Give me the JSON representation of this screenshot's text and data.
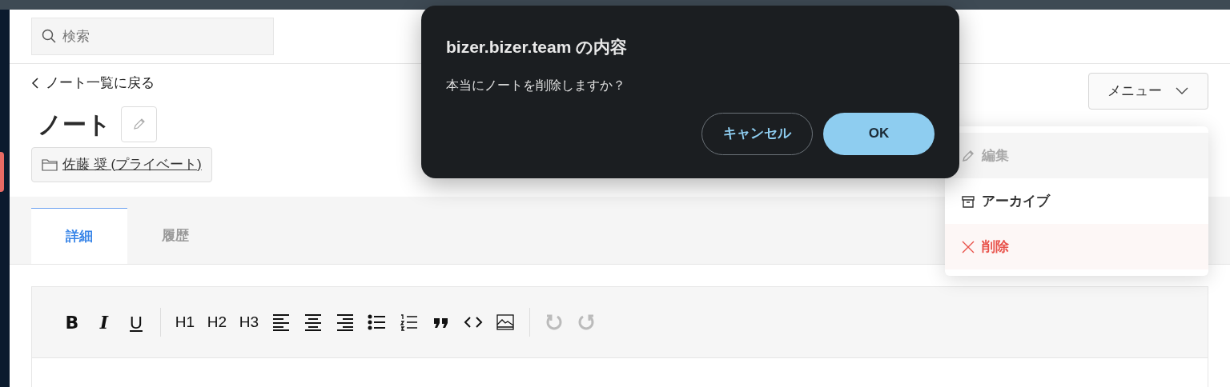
{
  "search": {
    "placeholder": "検索"
  },
  "back_link": "ノート一覧に戻る",
  "title": "ノート",
  "folder": "佐藤 奨 (プライベート)",
  "menu_button": "メニュー",
  "menu_items": [
    {
      "kind": "edit",
      "label": "編集",
      "disabled": true
    },
    {
      "kind": "archive",
      "label": "アーカイブ",
      "disabled": false
    },
    {
      "kind": "delete",
      "label": "削除",
      "disabled": false
    }
  ],
  "tabs": [
    {
      "label": "詳細",
      "selected": true
    },
    {
      "label": "履歴",
      "selected": false
    }
  ],
  "toolbar": [
    [
      {
        "kind": "bold",
        "label": "B"
      },
      {
        "kind": "italic",
        "label": "I"
      },
      {
        "kind": "underline",
        "label": "U"
      }
    ],
    [
      {
        "kind": "text",
        "label": "H1"
      },
      {
        "kind": "text",
        "label": "H2"
      },
      {
        "kind": "text",
        "label": "H3"
      },
      {
        "kind": "align-left"
      },
      {
        "kind": "align-center"
      },
      {
        "kind": "align-right"
      },
      {
        "kind": "bullet-list"
      },
      {
        "kind": "numbered-list"
      },
      {
        "kind": "quote"
      },
      {
        "kind": "code"
      },
      {
        "kind": "image"
      }
    ],
    [
      {
        "kind": "undo",
        "disabled": true
      },
      {
        "kind": "redo",
        "disabled": true
      }
    ]
  ],
  "dialog": {
    "title": "bizer.bizer.team の内容",
    "message": "本当にノートを削除しますか？",
    "buttons": [
      {
        "kind": "secondary",
        "label": "キャンセル"
      },
      {
        "kind": "primary",
        "label": "OK"
      }
    ]
  }
}
